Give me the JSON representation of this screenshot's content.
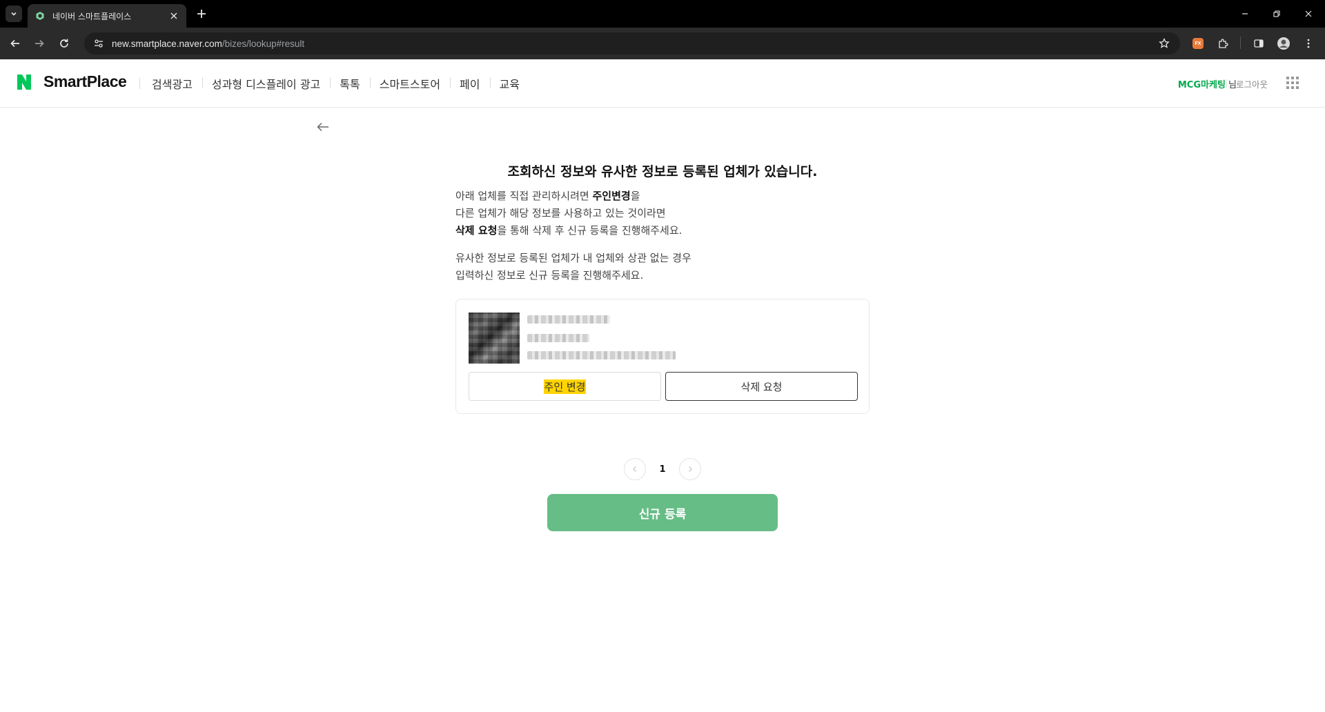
{
  "browser": {
    "tab_title": "네이버 스마트플레이스",
    "url_host": "new.smartplace.naver.com",
    "url_path": "/bizes/lookup#result"
  },
  "header": {
    "logo": "SmartPlace",
    "nav": [
      "검색광고",
      "성과형 디스플레이 광고",
      "톡톡",
      "스마트스토어",
      "페이",
      "교육"
    ],
    "user_name": "MCG마케팅",
    "user_suffix": " 님",
    "logout": "로그아웃"
  },
  "main": {
    "headline": "조회하신 정보와 유사한 정보로 등록된 업체가 있습니다.",
    "desc1_line1_pre": "아래 업체를 직접 관리하시려면 ",
    "desc1_line1_bold": "주인변경",
    "desc1_line1_post": "을",
    "desc1_line2": "다른 업체가 해당 정보를 사용하고 있는 것이라면",
    "desc1_line3_bold": "삭제 요청",
    "desc1_line3_post": "을 통해 삭제 후 신규 등록을 진행해주세요.",
    "desc2_line1": "유사한 정보로 등록된 업체가 내 업체와 상관 없는 경우",
    "desc2_line2": "입력하신 정보로 신규 등록을 진행해주세요.",
    "card": {
      "owner_change_label": "주인 변경",
      "delete_request_label": "삭제 요청"
    },
    "pagination": {
      "current_page": "1"
    },
    "cta_label": "신규 등록"
  },
  "colors": {
    "brand_green": "#03a94d",
    "cta_green": "#66bd86",
    "highlight": "#ffd400"
  }
}
